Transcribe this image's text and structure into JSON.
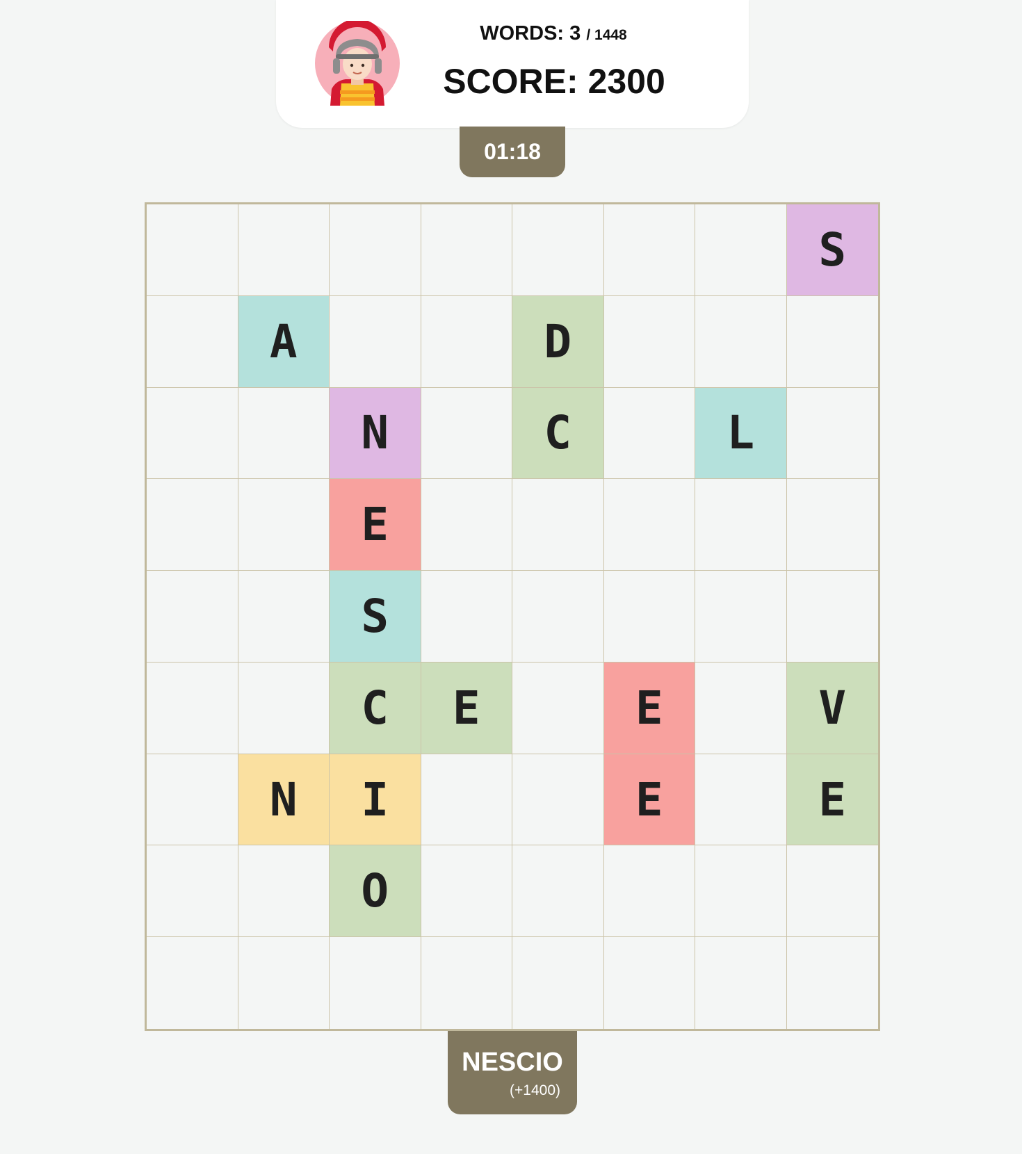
{
  "header": {
    "avatar_icon": "firefighter-avatar-icon",
    "words_label": "WORDS:",
    "words_found": "3",
    "words_total": "/ 1448",
    "score_label": "SCORE:",
    "score_value": "2300"
  },
  "timer": "01:18",
  "last_word": {
    "word": "NESCIO",
    "points": "(+1400)"
  },
  "colors": {
    "background": "#f4f6f5",
    "pill": "#80775e",
    "teal": "#b4e1dc",
    "green": "#ccdebb",
    "purple": "#dfb8e3",
    "red": "#f8a19e",
    "yellow": "#fae0a0"
  },
  "grid": {
    "cols": 8,
    "rows": 9,
    "cells": [
      [
        "",
        "",
        "",
        "",
        "",
        "",
        "",
        "S"
      ],
      [
        "",
        "A",
        "",
        "",
        "D",
        "",
        "",
        ""
      ],
      [
        "",
        "",
        "N",
        "",
        "C",
        "",
        "L",
        ""
      ],
      [
        "",
        "",
        "E",
        "",
        "",
        "",
        "",
        ""
      ],
      [
        "",
        "",
        "S",
        "",
        "",
        "",
        "",
        ""
      ],
      [
        "",
        "",
        "C",
        "E",
        "",
        "E",
        "",
        "V"
      ],
      [
        "",
        "N",
        "I",
        "",
        "",
        "E",
        "",
        "E"
      ],
      [
        "",
        "",
        "O",
        "",
        "",
        "",
        "",
        ""
      ],
      [
        "",
        "",
        "",
        "",
        "",
        "",
        "",
        ""
      ]
    ],
    "cell_colors": [
      [
        "",
        "",
        "",
        "",
        "",
        "",
        "",
        "purple"
      ],
      [
        "",
        "teal",
        "",
        "",
        "green",
        "",
        "",
        ""
      ],
      [
        "",
        "",
        "purple",
        "",
        "green",
        "",
        "teal",
        ""
      ],
      [
        "",
        "",
        "red",
        "",
        "",
        "",
        "",
        ""
      ],
      [
        "",
        "",
        "teal",
        "",
        "",
        "",
        "",
        ""
      ],
      [
        "",
        "",
        "green",
        "green",
        "",
        "red",
        "",
        "green"
      ],
      [
        "",
        "yellow",
        "yellow",
        "",
        "",
        "red",
        "",
        "green"
      ],
      [
        "",
        "",
        "green",
        "",
        "",
        "",
        "",
        ""
      ],
      [
        "",
        "",
        "",
        "",
        "",
        "",
        "",
        ""
      ]
    ]
  }
}
